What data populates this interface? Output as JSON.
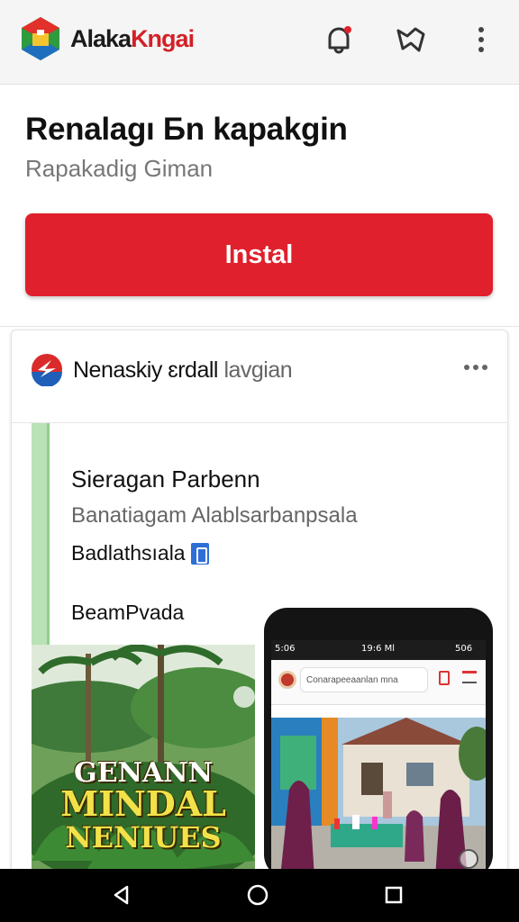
{
  "app_bar": {
    "name_part1": "Alaka",
    "name_part2": "Kngai",
    "icons": [
      "logo-icon",
      "notification-bell-icon",
      "map-icon",
      "more-vertical-icon"
    ]
  },
  "hero": {
    "title": "Renalagı Бn kapakgin",
    "subtitle": "Rapakadig Giman",
    "install_label": "Instal"
  },
  "card": {
    "title_main": "Nenaskiy ɛrdall",
    "title_grey": "lavgian",
    "question_title": "Sieragan Parbenn",
    "question_subtitle": "Banatiagam Alablsarbanpsala",
    "question_line": "Badlathsıala",
    "question_footer": "BeamPvada",
    "thumbnail_left_text": [
      "GENANN",
      "MINDAL",
      "NENIUES"
    ],
    "phone": {
      "status_time": "5:06",
      "status_mid": "19:6 Ml",
      "status_right": "506",
      "search_text": "Conarapeeaanlan mna"
    }
  },
  "colors": {
    "accent": "#e0202c",
    "appbar_bg": "#f5f5f5",
    "quote_bar": "#b9e2b6"
  },
  "nav": {
    "icons": [
      "back-icon",
      "home-icon",
      "recents-icon"
    ]
  }
}
